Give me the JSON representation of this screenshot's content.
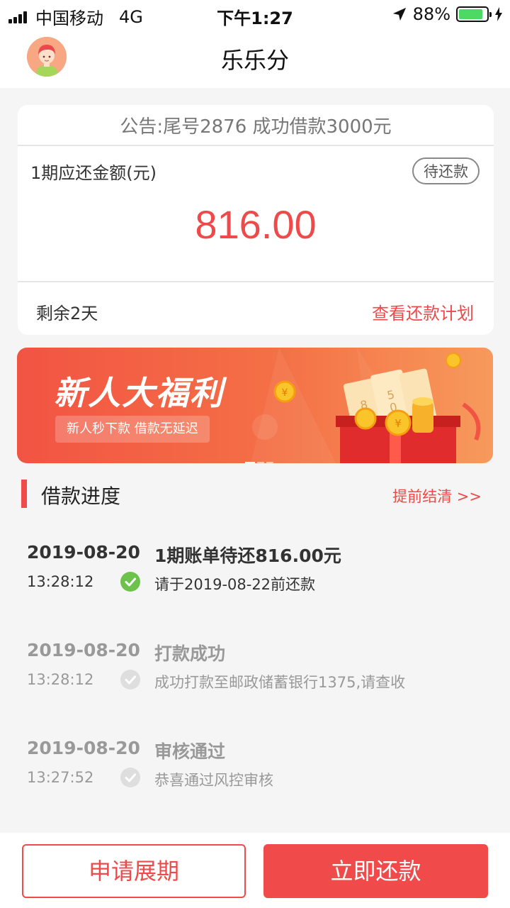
{
  "status_bar": {
    "carrier": "中国移动",
    "network": "4G",
    "time": "下午1:27",
    "battery": "88%",
    "battery_level": 0.88
  },
  "header": {
    "title": "乐乐分",
    "avatar_icon": "user-avatar-icon"
  },
  "repayment_card": {
    "notice": "公告:尾号2876 成功借款3000元",
    "amount_label": "1期应还金额(元)",
    "status": "待还款",
    "amount": "816.00",
    "remaining": "剩余2天",
    "plan_link": "查看还款计划"
  },
  "banner": {
    "title": "新人大福利",
    "subtitle": "新人秒下款  借款无延迟",
    "slide_count": 3,
    "active_slide": 0
  },
  "progress": {
    "title": "借款进度",
    "settle_link": "提前结清    >>",
    "steps": [
      {
        "date": "2019-08-20",
        "time": "13:28:12",
        "title": "1期账单待还816.00元",
        "desc": "请于2019-08-22前还款",
        "state": "active"
      },
      {
        "date": "2019-08-20",
        "time": "13:28:12",
        "title": "打款成功",
        "desc": "成功打款至邮政储蓄银行1375,请查收",
        "state": "done"
      },
      {
        "date": "2019-08-20",
        "time": "13:27:52",
        "title": "审核通过",
        "desc": "恭喜通过风控审核",
        "state": "done"
      }
    ]
  },
  "actions": {
    "extend_label": "申请展期",
    "repay_label": "立即还款"
  },
  "colors": {
    "accent": "#f04a4a",
    "check_active": "#6cc24a",
    "check_done": "#dedede"
  }
}
